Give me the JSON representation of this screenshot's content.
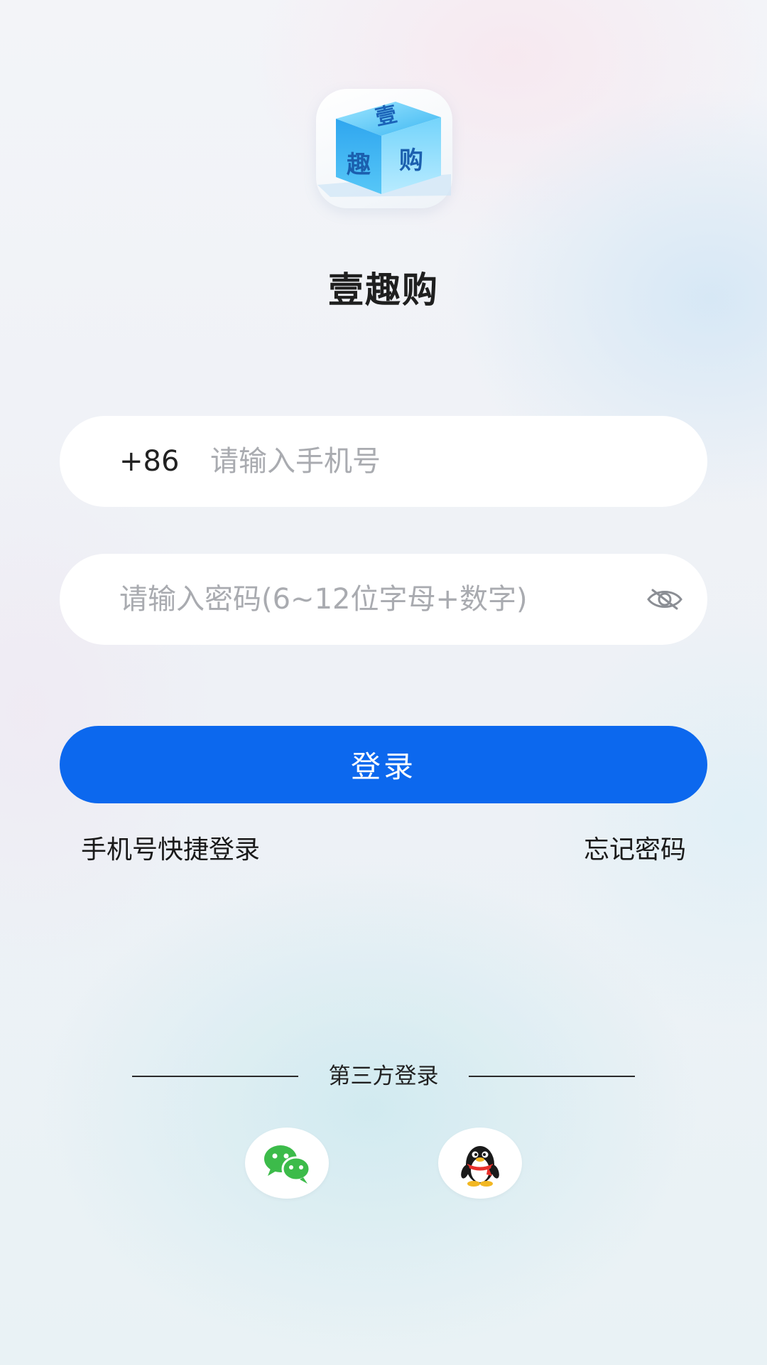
{
  "app": {
    "name": "壹趣购",
    "logo_chars": [
      "壹",
      "趣",
      "购"
    ]
  },
  "login": {
    "phone": {
      "prefix": "+86",
      "placeholder": "请输入手机号"
    },
    "password": {
      "placeholder": "请输入密码(6~12位字母+数字)",
      "visibility_icon": "eye-closed-icon"
    },
    "login_button": "登录",
    "quick_login_link": "手机号快捷登录",
    "forgot_password_link": "忘记密码"
  },
  "third_party": {
    "label": "第三方登录",
    "providers": [
      {
        "name": "wechat",
        "icon": "wechat-icon"
      },
      {
        "name": "qq",
        "icon": "qq-penguin-icon"
      }
    ]
  },
  "colors": {
    "primary": "#0c68ee",
    "wechat_green": "#3cbb4a",
    "placeholder": "#a9abb0"
  }
}
